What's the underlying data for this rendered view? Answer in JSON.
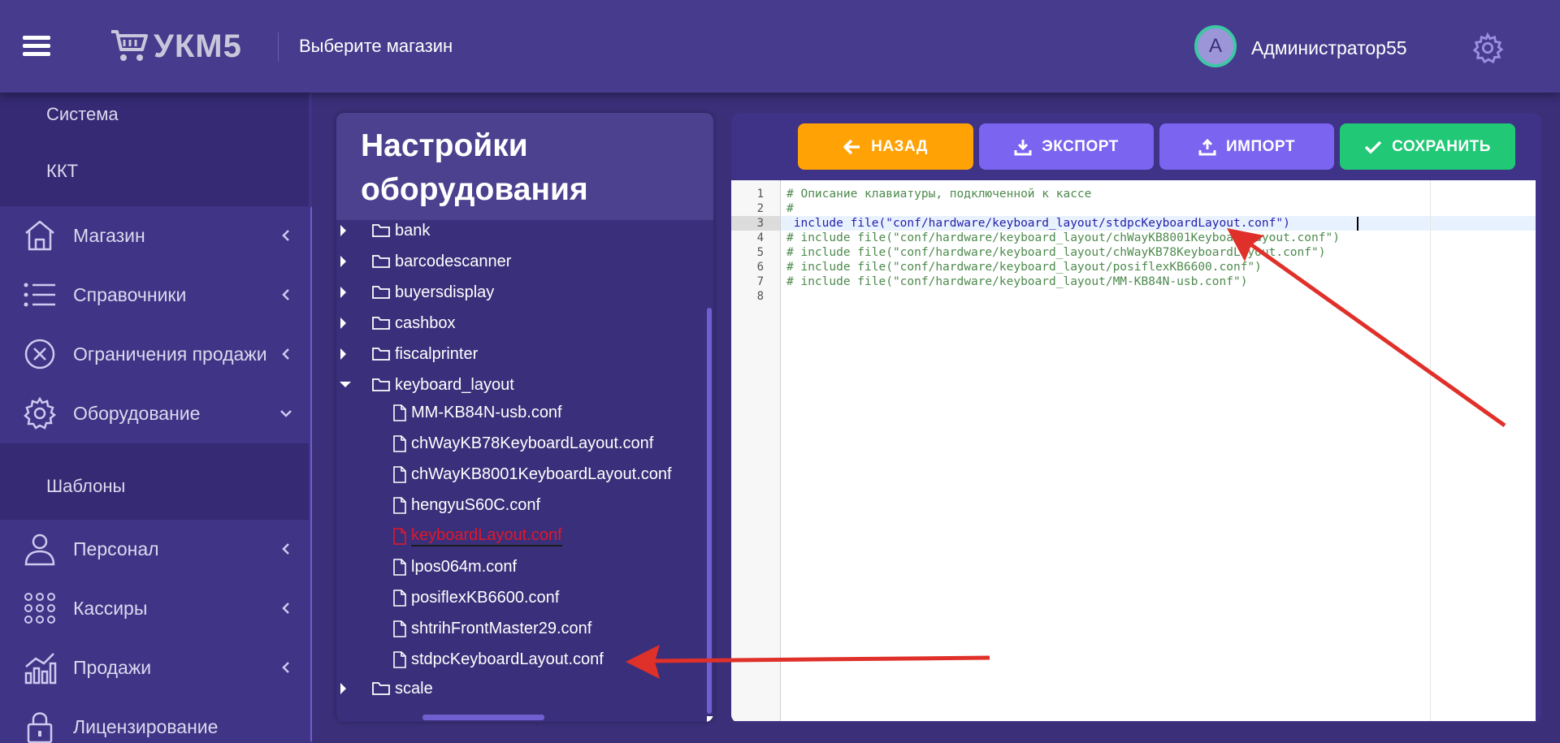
{
  "header": {
    "logo_text": "УКМ5",
    "store_label": "Выберите магазин",
    "avatar_letter": "A",
    "username": "Администратор55"
  },
  "sidebar": {
    "sub_top": [
      "Система",
      "ККТ"
    ],
    "items": [
      {
        "label": "Магазин",
        "icon": "store-icon"
      },
      {
        "label": "Справочники",
        "icon": "list-icon"
      },
      {
        "label": "Ограничения продажи",
        "icon": "restriction-icon"
      },
      {
        "label": "Оборудование",
        "icon": "gear-icon"
      },
      {
        "label": "Персонал",
        "icon": "user-icon"
      },
      {
        "label": "Кассиры",
        "icon": "grid-icon"
      },
      {
        "label": "Продажи",
        "icon": "chart-icon"
      },
      {
        "label": "Лицензирование",
        "icon": "lock-icon"
      }
    ],
    "sub_equipment": [
      "Шаблоны"
    ]
  },
  "panel": {
    "title": "Настройки оборудования",
    "folders_top": [
      "bank",
      "barcodescanner",
      "buyersdisplay",
      "cashbox",
      "fiscalprinter"
    ],
    "open_folder": "keyboard_layout",
    "files": [
      "MM-KB84N-usb.conf",
      "chWayKB78KeyboardLayout.conf",
      "chWayKB8001KeyboardLayout.conf",
      "hengyuS60C.conf",
      "keyboardLayout.conf",
      "lpos064m.conf",
      "posiflexKB6600.conf",
      "shtrihFrontMaster29.conf",
      "stdpcKeyboardLayout.conf"
    ],
    "selected_file": "keyboardLayout.conf",
    "folders_bottom": [
      "scale"
    ]
  },
  "toolbar": {
    "back": "НАЗАД",
    "export": "ЭКСПОРТ",
    "import": "ИМПОРТ",
    "save": "СОХРАНИТЬ"
  },
  "editor": {
    "line_numbers": [
      "1",
      "2",
      "3",
      "4",
      "5",
      "6",
      "7",
      "8"
    ],
    "lines": [
      "# Описание клавиатуры, подключенной к кассе",
      "#",
      " include file(\"conf/hardware/keyboard_layout/stdpcKeyboardLayout.conf\")",
      "# include file(\"conf/hardware/keyboard_layout/chWayKB8001KeyboardLayout.conf\")",
      "# include file(\"conf/hardware/keyboard_layout/chWayKB78KeyboardLayout.conf\")",
      "# include file(\"conf/hardware/keyboard_layout/posiflexKB6600.conf\")",
      "# include file(\"conf/hardware/keyboard_layout/MM-KB84N-usb.conf\")",
      ""
    ],
    "active_line": 3
  },
  "colors": {
    "header_bg": "#463b8c",
    "back_button": "#ffa205",
    "export_import_button": "#7a64f0",
    "save_button": "#21c876",
    "selected_file": "#e0182a",
    "annotation_arrow": "#e0302a"
  }
}
